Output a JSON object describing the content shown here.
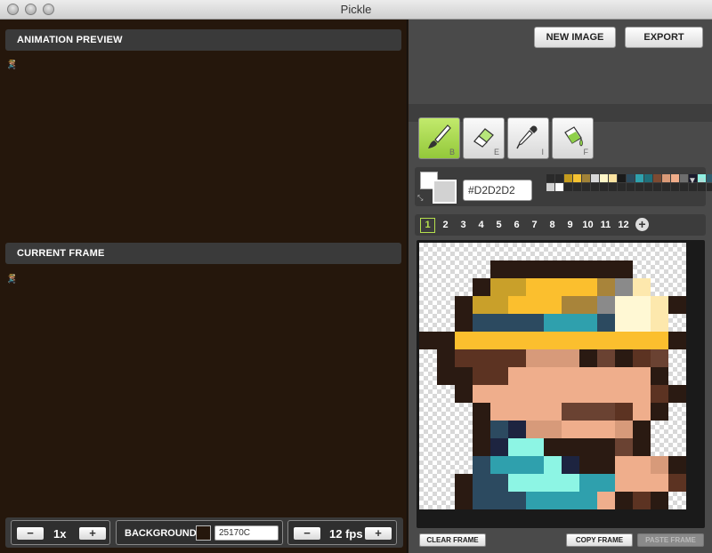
{
  "window": {
    "title": "Pickle"
  },
  "preview": {
    "header": "ANIMATION PREVIEW"
  },
  "current_frame": {
    "header": "CURRENT FRAME"
  },
  "zoom": {
    "minus": "−",
    "value": "1x",
    "plus": "+"
  },
  "background": {
    "label": "BACKGROUND",
    "hex": "25170C",
    "color": "#25170c"
  },
  "fps": {
    "minus": "−",
    "value": "12 fps",
    "plus": "+"
  },
  "toolbar": {
    "new_image": "NEW IMAGE",
    "export": "EXPORT"
  },
  "tools": [
    {
      "name": "brush-icon",
      "key": "B",
      "active": true
    },
    {
      "name": "eraser-icon",
      "key": "E",
      "active": false
    },
    {
      "name": "eyedropper-icon",
      "key": "I",
      "active": false
    },
    {
      "name": "fill-icon",
      "key": "F",
      "active": false
    }
  ],
  "color": {
    "current_hex": "#D2D2D2",
    "primary": "#d2d2d2",
    "secondary": "#ffffff"
  },
  "palette": [
    [
      "#2a2a2a",
      "#2a2a2a",
      "#c49b1e",
      "#f5c232",
      "#a08238",
      "#d8d8d8",
      "#fff6c8",
      "#fce3a0",
      "#1a1a1a",
      "#2c4a5c",
      "#2fa1ad",
      "#1f6f7a",
      "#7c4a32",
      "#d99a78",
      "#f0ad8a",
      "#6e6e6e",
      "#1b1b2c",
      "#8ef0e2",
      "#2e5c6e",
      "#a0a0a0"
    ],
    [
      "#d2d2d2",
      "#ffffff",
      "#2a2a2a",
      "#2a2a2a",
      "#2a2a2a",
      "#2a2a2a",
      "#2a2a2a",
      "#2a2a2a",
      "#2a2a2a",
      "#2a2a2a",
      "#2a2a2a",
      "#2a2a2a",
      "#2a2a2a",
      "#2a2a2a",
      "#2a2a2a",
      "#2a2a2a",
      "#2a2a2a",
      "#2a2a2a",
      "#2a2a2a",
      "#2a2a2a"
    ]
  ],
  "frames": {
    "items": [
      "1",
      "2",
      "3",
      "4",
      "5",
      "6",
      "7",
      "8",
      "9",
      "10",
      "11",
      "12"
    ],
    "active": "1",
    "add_label": "+"
  },
  "sprite": {
    "palette": {
      "0": null,
      "1": "#2a1a12",
      "2": "#c9a02a",
      "3": "#fbbf2e",
      "4": "#a8843a",
      "5": "#8a8a8a",
      "6": "#fff8d4",
      "7": "#fde8ad",
      "8": "#2c4a60",
      "9": "#2fa0ad",
      "A": "#5c3322",
      "B": "#d79a7a",
      "C": "#efae8c",
      "D": "#6a4232",
      "E": "#1d2440",
      "F": "#8df5e4",
      "G": "#2f6f7e",
      "H": "#3d3d3d",
      "I": "#dcdcdc",
      "J": "#c0c0c0"
    },
    "rows": [
      "000000000000000",
      "000011111111000",
      "000122333345700",
      "001223334456671",
      "001888899986670",
      "113333333333331",
      "01AAAABBB1D1AD0",
      "011AACCCCCCCC10",
      "001CCCCCCCCCCA1",
      "0001CCCCDDDAC10",
      "00018EBBCCCB100",
      "0001EFF1111D100",
      "0008999FE11CCB1",
      "00188FFFF99CCCA",
      "0018889999C1A10",
      "01999898888110",
      "0JH98888E8888H10",
      "0JH8E8EEE88888H1",
      "001I1111111IIJ10",
      "000000000000000"
    ]
  },
  "frame_actions": {
    "clear": "CLEAR FRAME",
    "copy": "COPY FRAME",
    "paste": "PASTE FRAME"
  }
}
